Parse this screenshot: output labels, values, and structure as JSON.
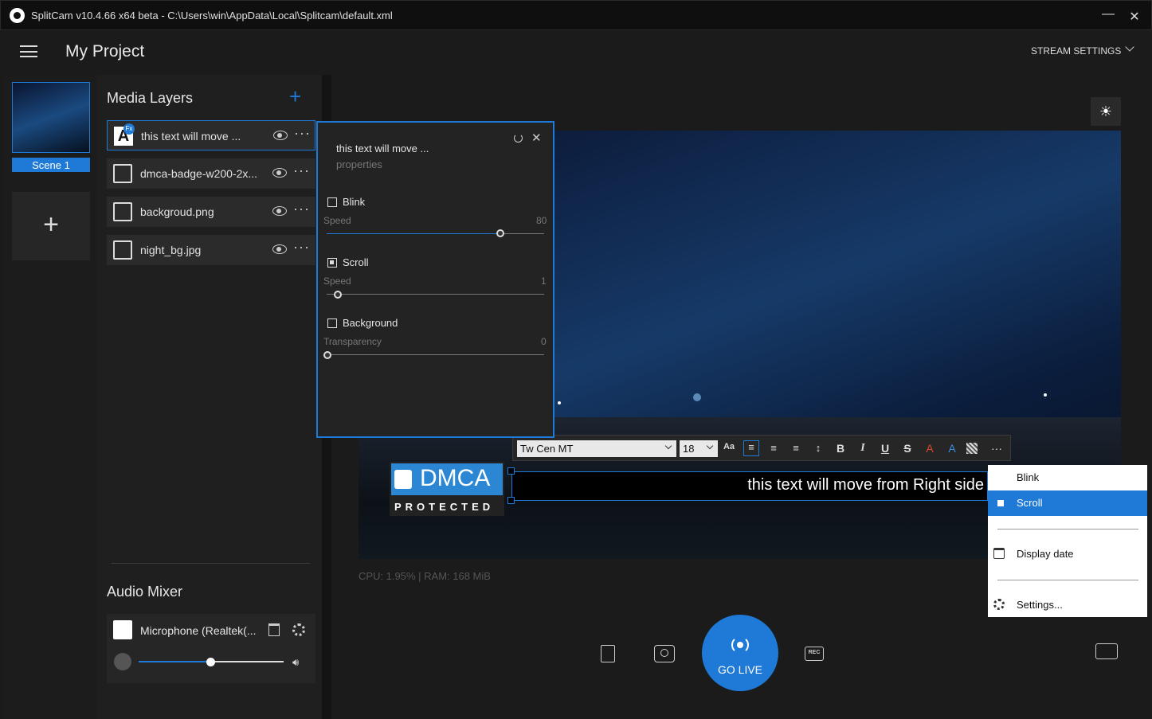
{
  "titlebar": {
    "title": "SplitCam v10.4.66 x64 beta - C:\\Users\\win\\AppData\\Local\\Splitcam\\default.xml",
    "minimize": "—",
    "close": "✕"
  },
  "header": {
    "project": "My Project",
    "stream_settings": "STREAM SETTINGS"
  },
  "scenes": {
    "scene_label": "Scene 1",
    "add": "+"
  },
  "layers": {
    "title": "Media Layers",
    "items": [
      {
        "name": "this text will move ..."
      },
      {
        "name": "dmca-badge-w200-2x..."
      },
      {
        "name": "backgroud.png"
      },
      {
        "name": "night_bg.jpg"
      }
    ]
  },
  "audio": {
    "title": "Audio Mixer",
    "device": "Microphone  (Realtek(...",
    "volume": 0.5
  },
  "props": {
    "title": "this text will move ...",
    "subtitle": "properties",
    "blink": {
      "label": "Blink",
      "checked": false,
      "slider_label": "Speed",
      "value": "80"
    },
    "scroll": {
      "label": "Scroll",
      "checked": true,
      "slider_label": "Speed",
      "value": "1"
    },
    "background": {
      "label": "Background",
      "checked": false,
      "slider_label": "Transparency",
      "value": "0"
    }
  },
  "toolbar": {
    "font": "Tw Cen MT",
    "size": "18"
  },
  "preview": {
    "overlay_text": "this text will move from Right side",
    "dmca_word": "DMCA",
    "dmca_sub": "PROTECTED",
    "stats": "CPU: 1.95% | RAM: 168 MiB"
  },
  "context_menu": {
    "blink": "Blink",
    "scroll": "Scroll",
    "display_date": "Display date",
    "settings": "Settings..."
  },
  "controls": {
    "golive": "GO LIVE",
    "rec": "REC"
  },
  "colors": {
    "accent": "#1e7ad6"
  }
}
